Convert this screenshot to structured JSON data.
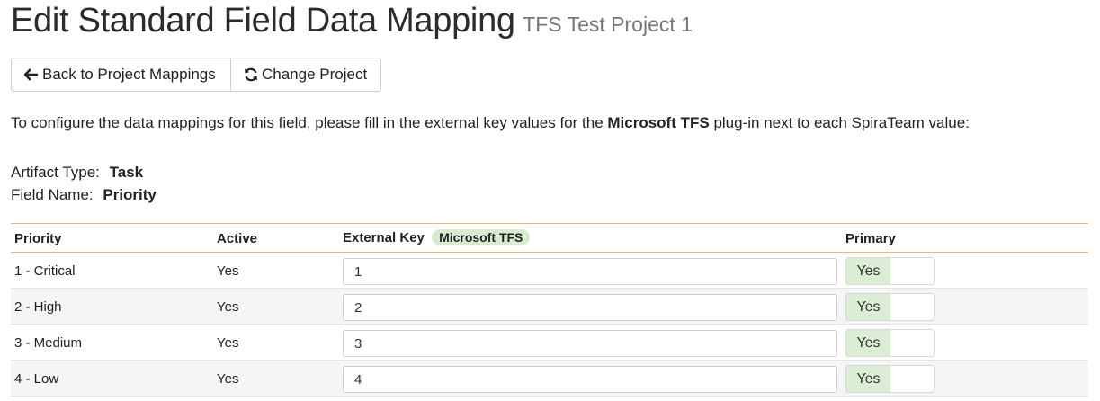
{
  "header": {
    "title": "Edit Standard Field Data Mapping",
    "subtitle": "TFS Test Project 1"
  },
  "toolbar": {
    "back_label": "Back to Project Mappings",
    "change_label": "Change Project"
  },
  "instructions": {
    "before": "To configure the data mappings for this field, please fill in the external key values for the ",
    "plugin": "Microsoft TFS",
    "after": " plug-in next to each SpiraTeam value:"
  },
  "meta": {
    "artifact_label": "Artifact Type:",
    "artifact_value": "Task",
    "field_label": "Field Name:",
    "field_value": "Priority"
  },
  "table": {
    "headers": {
      "priority": "Priority",
      "active": "Active",
      "external_key": "External Key",
      "plugin_badge": "Microsoft TFS",
      "primary": "Primary"
    },
    "rows": [
      {
        "priority": "1 - Critical",
        "active": "Yes",
        "key": "1",
        "primary": "Yes"
      },
      {
        "priority": "2 - High",
        "active": "Yes",
        "key": "2",
        "primary": "Yes"
      },
      {
        "priority": "3 - Medium",
        "active": "Yes",
        "key": "3",
        "primary": "Yes"
      },
      {
        "priority": "4 - Low",
        "active": "Yes",
        "key": "4",
        "primary": "Yes"
      }
    ]
  },
  "icons": {
    "back": "arrow-left-icon",
    "change": "refresh-icon"
  },
  "colors": {
    "header_border": "#f2b36b",
    "badge_bg": "#d9ecd2",
    "toggle_on_bg": "#dcedd5"
  }
}
